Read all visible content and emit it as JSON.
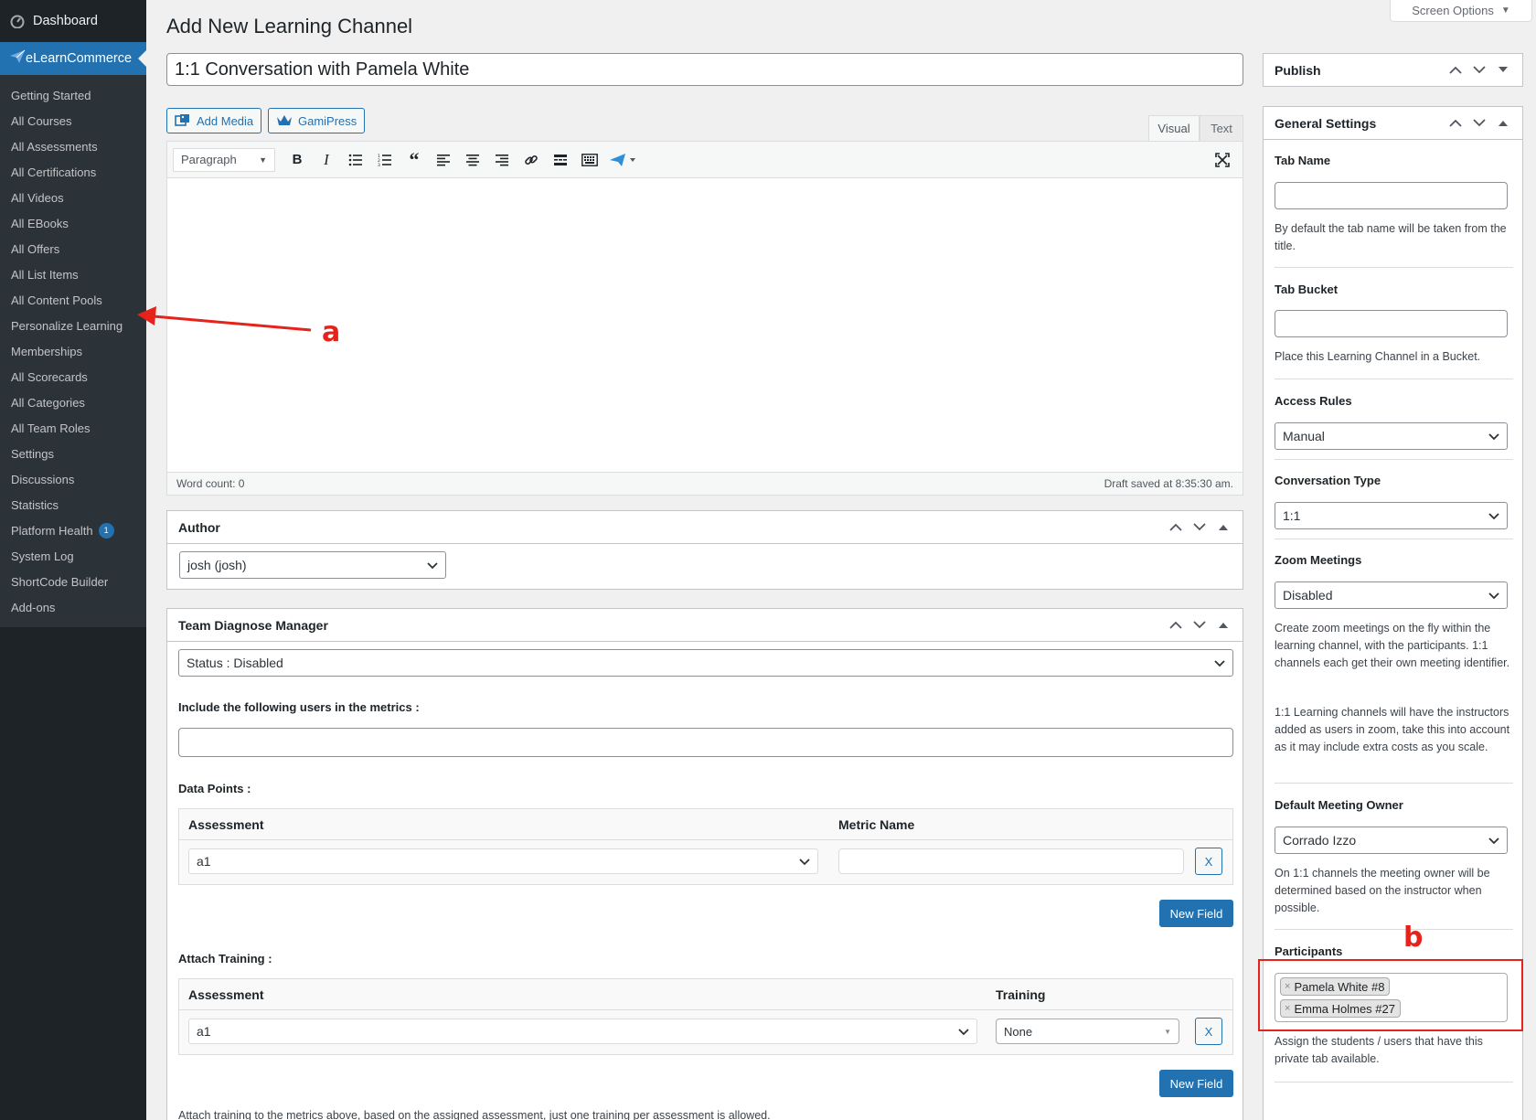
{
  "sidebar": {
    "dashboard": "Dashboard",
    "current": "eLearnCommerce",
    "items": [
      {
        "label": "Getting Started"
      },
      {
        "label": "All Courses"
      },
      {
        "label": "All Assessments"
      },
      {
        "label": "All Certifications"
      },
      {
        "label": "All Videos"
      },
      {
        "label": "All EBooks"
      },
      {
        "label": "All Offers"
      },
      {
        "label": "All List Items"
      },
      {
        "label": "All Content Pools"
      },
      {
        "label": "Personalize Learning"
      },
      {
        "label": "Memberships"
      },
      {
        "label": "All Scorecards"
      },
      {
        "label": "All Categories"
      },
      {
        "label": "All Team Roles"
      },
      {
        "label": "Settings"
      },
      {
        "label": "Discussions"
      },
      {
        "label": "Statistics"
      },
      {
        "label": "Platform Health",
        "badge": "1"
      },
      {
        "label": "System Log"
      },
      {
        "label": "ShortCode Builder"
      },
      {
        "label": "Add-ons"
      }
    ]
  },
  "header": {
    "page_title": "Add New Learning Channel",
    "screen_options": "Screen Options"
  },
  "editor": {
    "post_title": "1:1 Conversation with Pamela White",
    "add_media": "Add Media",
    "gamipress": "GamiPress",
    "tab_visual": "Visual",
    "tab_text": "Text",
    "format": "Paragraph",
    "word_count": "Word count: 0",
    "draft_saved": "Draft saved at 8:35:30 am."
  },
  "author_box": {
    "title": "Author",
    "selected": "josh (josh)"
  },
  "team_box": {
    "title": "Team Diagnose Manager",
    "status": "Status : Disabled",
    "include_label": "Include the following users in the metrics :",
    "data_points_label": "Data Points :",
    "dp_col_assessment": "Assessment",
    "dp_col_metric": "Metric Name",
    "dp_row_assessment": "a1",
    "x_label": "X",
    "new_field": "New Field",
    "attach_label": "Attach Training :",
    "at_col_assessment": "Assessment",
    "at_col_training": "Training",
    "at_row_assessment": "a1",
    "at_row_training": "None",
    "footer_note": "Attach training to the metrics above, based on the assigned assessment, just one training per assessment is allowed."
  },
  "publish_box": {
    "title": "Publish"
  },
  "settings_box": {
    "title": "General Settings",
    "tab_name_label": "Tab Name",
    "tab_name_help": "By default the tab name will be taken from the title.",
    "tab_bucket_label": "Tab Bucket",
    "tab_bucket_help": "Place this Learning Channel in a Bucket.",
    "access_label": "Access Rules",
    "access_value": "Manual",
    "conv_label": "Conversation Type",
    "conv_value": "1:1",
    "zoom_label": "Zoom Meetings",
    "zoom_value": "Disabled",
    "zoom_help_1": "Create zoom meetings on the fly within the learning channel, with the participants. 1:1 channels each get their own meeting identifier.",
    "zoom_help_2": "1:1 Learning channels will have the instructors added as users in zoom, take this into account as it may include extra costs as you scale.",
    "owner_label": "Default Meeting Owner",
    "owner_value": "Corrado Izzo",
    "owner_help": "On 1:1 channels the meeting owner will be determined based on the instructor when possible.",
    "participants_label": "Participants",
    "participants": [
      "Pamela White #8",
      "Emma Holmes #27"
    ],
    "participants_help": "Assign the students / users that have this private tab available."
  },
  "annotations": {
    "a": "a",
    "b": "b",
    "color": "#e5231b"
  },
  "colors": {
    "accent": "#2271b1",
    "sidebar_bg": "#1d2327",
    "page_bg": "#f0f0f1"
  }
}
